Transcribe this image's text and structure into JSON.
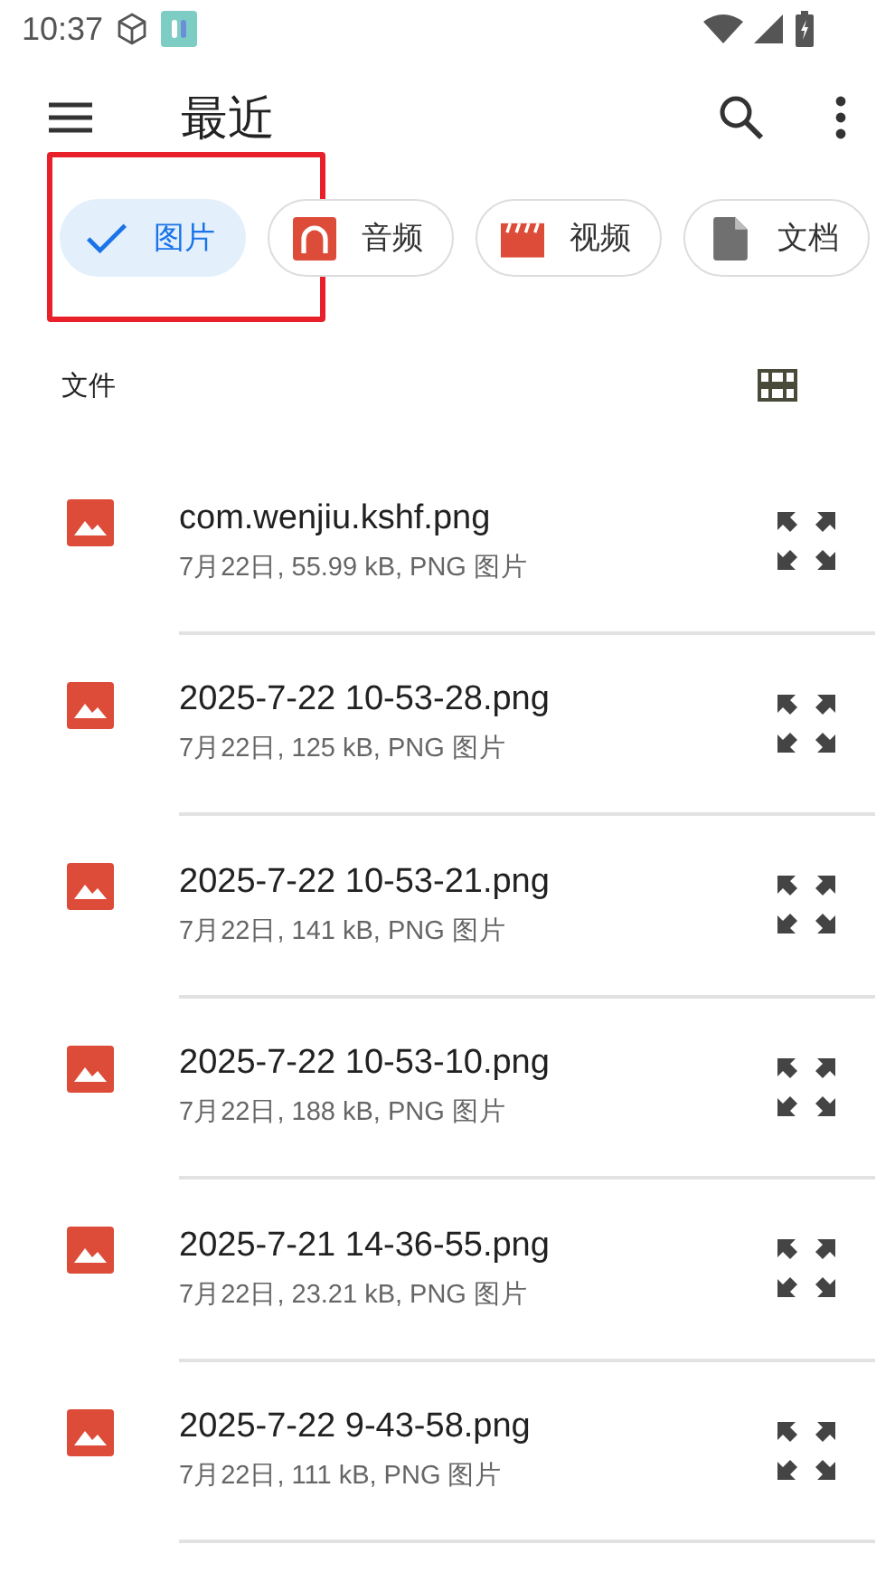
{
  "status_bar": {
    "time": "10:37"
  },
  "toolbar": {
    "title": "最近"
  },
  "chips": [
    {
      "label": "图片",
      "kind": "image",
      "selected": true,
      "annotated": true
    },
    {
      "label": "音频",
      "kind": "audio",
      "selected": false,
      "annotated": false
    },
    {
      "label": "视频",
      "kind": "video",
      "selected": false,
      "annotated": false
    },
    {
      "label": "文档",
      "kind": "doc",
      "selected": false,
      "annotated": false
    }
  ],
  "section": {
    "label": "文件"
  },
  "files": [
    {
      "name": "com.wenjiu.kshf.png",
      "details": "7月22日, 55.99 kB, PNG 图片"
    },
    {
      "name": "2025-7-22 10-53-28.png",
      "details": "7月22日, 125 kB, PNG 图片"
    },
    {
      "name": "2025-7-22 10-53-21.png",
      "details": "7月22日, 141 kB, PNG 图片"
    },
    {
      "name": "2025-7-22 10-53-10.png",
      "details": "7月22日, 188 kB, PNG 图片"
    },
    {
      "name": "2025-7-21 14-36-55.png",
      "details": "7月22日, 23.21 kB, PNG 图片"
    },
    {
      "name": "2025-7-22 9-43-58.png",
      "details": "7月22日, 111 kB, PNG 图片"
    }
  ]
}
